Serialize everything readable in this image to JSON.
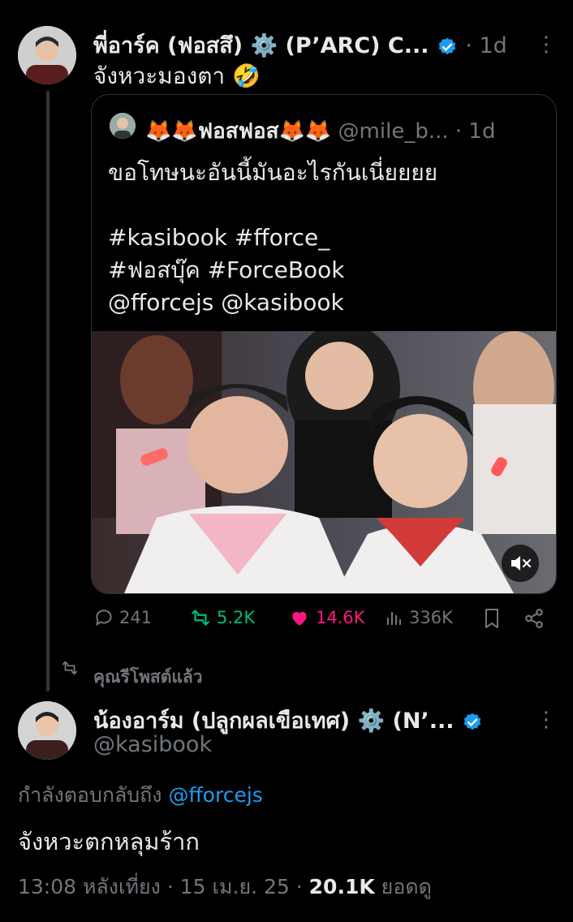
{
  "tweet1": {
    "author": "พี่อาร์ค (ฟอสสึ) ⚙️ (P’ARC) C...",
    "time": "· 1d",
    "text": "จังหวะมองตา 🤣",
    "quote": {
      "author": "🦊🦊ฟอสฟอส🦊🦊",
      "handle": "@mile_b...",
      "time": "· 1d",
      "line1": "ขอโทษนะอันนี้มันอะไรกันเนี่ยยยย",
      "line2": "#kasibook #fforce_",
      "line3": "#ฟอสบุ๊ค #ForceBook",
      "line4": "@fforcejs @kasibook"
    },
    "actions": {
      "replies": "241",
      "reposts": "5.2K",
      "likes": "14.6K",
      "views": "336K"
    }
  },
  "repost_label": "คุณรีโพสต์แล้ว",
  "tweet2": {
    "author": "น้องอาร์ม (ปลูกผลเขือเทศ) ⚙️ (N’...",
    "handle": "@kasibook",
    "reply_prefix": "กำลังตอบกลับถึง",
    "reply_to": "@fforcejs",
    "text": "จังหวะตกหลุมร้าก",
    "timestamp": "13:08 หลังเที่ยง · 15 เม.ย. 25 · ",
    "views_count": "20.1K",
    "views_label": "ยอดดู"
  },
  "colors": {
    "accent": "#1d9bf0",
    "repost": "#00ba7c",
    "like": "#f91880",
    "muted": "#71767b"
  }
}
